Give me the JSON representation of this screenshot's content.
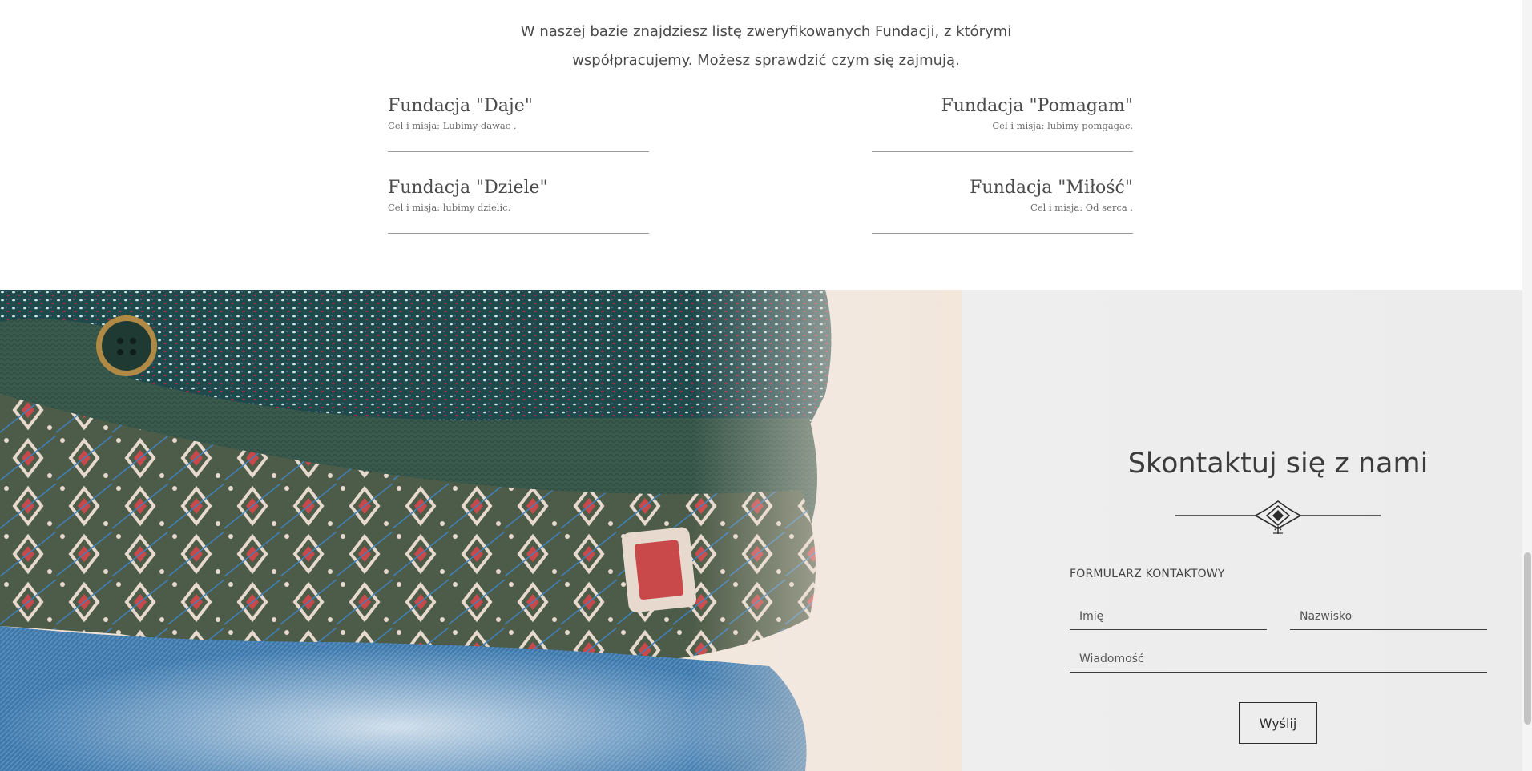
{
  "intro": {
    "line1": "W naszej bazie znajdziesz listę zweryfikowanych Fundacji, z którymi",
    "line2": "współpracujemy. Możesz sprawdzić czym się zajmują."
  },
  "foundations": [
    {
      "name": "Fundacja \"Daje\"",
      "desc": "Cel i misja: Lubimy dawac ."
    },
    {
      "name": "Fundacja \"Pomagam\"",
      "desc": "Cel i misja: lubimy pomgagac."
    },
    {
      "name": "Fundacja \"Dziele\"",
      "desc": "Cel i misja: lubimy dzielic."
    },
    {
      "name": "Fundacja \"Miłość\"",
      "desc": "Cel i misja: Od serca ."
    }
  ],
  "contact": {
    "title": "Skontaktuj się z nami",
    "form_label": "FORMULARZ KONTAKTOWY",
    "first_name_placeholder": "Imię",
    "last_name_placeholder": "Nazwisko",
    "message_placeholder": "Wiadomość",
    "send_label": "Wyślij"
  },
  "icons": {
    "ornament": "decorative-divider-icon"
  }
}
